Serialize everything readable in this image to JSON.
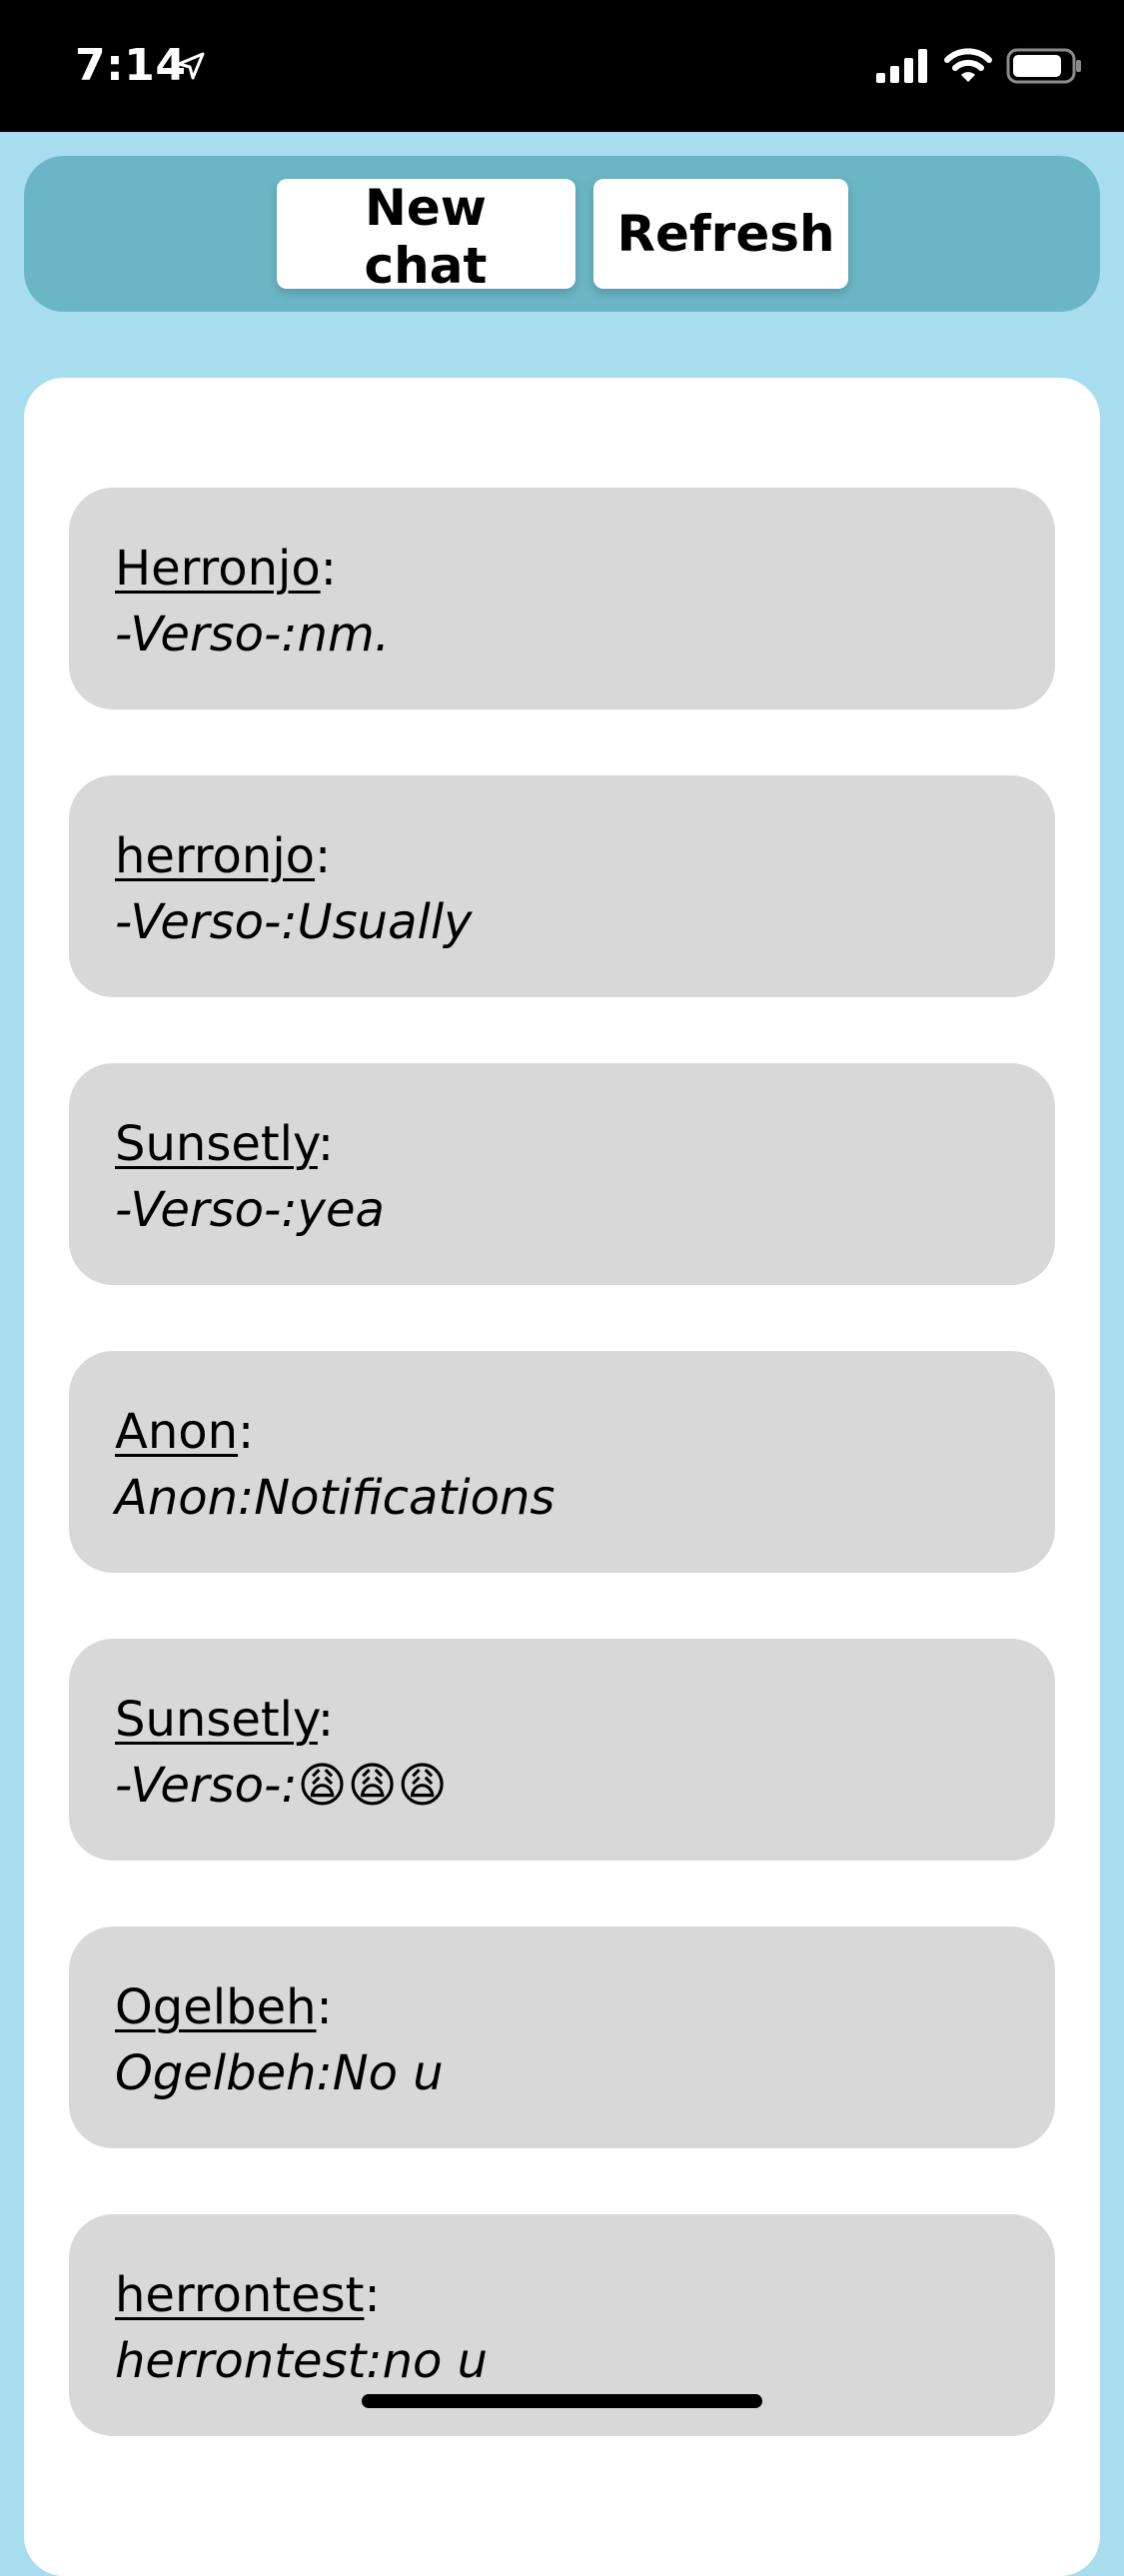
{
  "status_bar": {
    "time": "7:14",
    "icons": [
      "location-arrow-icon",
      "cellular-signal-icon",
      "wifi-icon",
      "battery-icon"
    ],
    "background": "#000000"
  },
  "toolbar": {
    "new_chat_label": "New chat",
    "refresh_label": "Refresh",
    "background": "#6bb6c6"
  },
  "chats": [
    {
      "name": "Herronjo",
      "sep": ":",
      "preview": "-Verso-:nm."
    },
    {
      "name": "herronjo",
      "sep": ":",
      "preview": "-Verso-:Usually"
    },
    {
      "name": "Sunsetly",
      "sep": ":",
      "preview": "-Verso-:yea"
    },
    {
      "name": "Anon",
      "sep": ":",
      "preview": "Anon:Notifications"
    },
    {
      "name": "Sunsetly",
      "sep": ":",
      "preview": "-Verso-:😩😩😩"
    },
    {
      "name": "Ogelbeh",
      "sep": ":",
      "preview": "Ogelbeh:No u"
    },
    {
      "name": "herrontest",
      "sep": ":",
      "preview": "herrontest:no u"
    }
  ],
  "colors": {
    "page_background": "#a8dcef",
    "card_background": "#d8d8d8",
    "panel_background": "#ffffff"
  }
}
